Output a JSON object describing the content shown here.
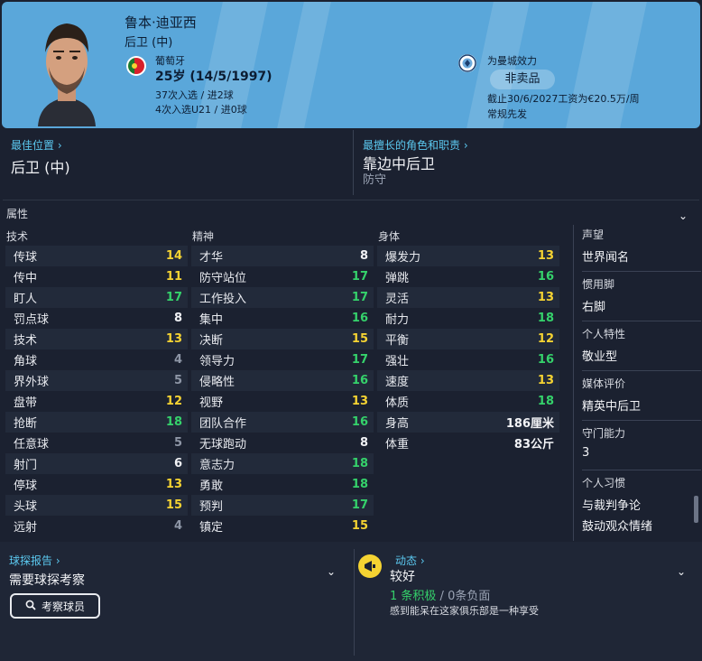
{
  "player": {
    "name": "鲁本·迪亚西",
    "position": "后卫 (中)",
    "nationality": "葡萄牙",
    "age": "25岁",
    "dob": "(14/5/1997)",
    "caps": "37次入选 / 进2球",
    "u21_caps": "4次入选U21 / 进0球"
  },
  "club": {
    "plays_for": "为曼城效力",
    "not_for_sale": "非卖品",
    "contract": "截止30/6/2027工资为€20.5万/周",
    "squad_role": "常规先发"
  },
  "positions": {
    "best_label": "最佳位置",
    "best_value": "后卫 (中)",
    "role_label": "最擅长的角色和职责",
    "role_value": "靠边中后卫",
    "duty": "防守"
  },
  "attributes": {
    "section_title": "属性",
    "technical_title": "技术",
    "mental_title": "精神",
    "physical_title": "身体",
    "technical": [
      {
        "name": "传球",
        "value": "14",
        "tone": "yellow"
      },
      {
        "name": "传中",
        "value": "11",
        "tone": "yellow"
      },
      {
        "name": "盯人",
        "value": "17",
        "tone": "green"
      },
      {
        "name": "罚点球",
        "value": "8",
        "tone": "white"
      },
      {
        "name": "技术",
        "value": "13",
        "tone": "yellow"
      },
      {
        "name": "角球",
        "value": "4",
        "tone": "gray"
      },
      {
        "name": "界外球",
        "value": "5",
        "tone": "gray"
      },
      {
        "name": "盘带",
        "value": "12",
        "tone": "yellow"
      },
      {
        "name": "抢断",
        "value": "18",
        "tone": "green"
      },
      {
        "name": "任意球",
        "value": "5",
        "tone": "gray"
      },
      {
        "name": "射门",
        "value": "6",
        "tone": "white"
      },
      {
        "name": "停球",
        "value": "13",
        "tone": "yellow"
      },
      {
        "name": "头球",
        "value": "15",
        "tone": "yellow"
      },
      {
        "name": "远射",
        "value": "4",
        "tone": "gray"
      }
    ],
    "mental": [
      {
        "name": "才华",
        "value": "8",
        "tone": "white"
      },
      {
        "name": "防守站位",
        "value": "17",
        "tone": "green"
      },
      {
        "name": "工作投入",
        "value": "17",
        "tone": "green"
      },
      {
        "name": "集中",
        "value": "16",
        "tone": "green"
      },
      {
        "name": "决断",
        "value": "15",
        "tone": "yellow"
      },
      {
        "name": "领导力",
        "value": "17",
        "tone": "green"
      },
      {
        "name": "侵略性",
        "value": "16",
        "tone": "green"
      },
      {
        "name": "视野",
        "value": "13",
        "tone": "yellow"
      },
      {
        "name": "团队合作",
        "value": "16",
        "tone": "green"
      },
      {
        "name": "无球跑动",
        "value": "8",
        "tone": "white"
      },
      {
        "name": "意志力",
        "value": "18",
        "tone": "green"
      },
      {
        "name": "勇敢",
        "value": "18",
        "tone": "green"
      },
      {
        "name": "预判",
        "value": "17",
        "tone": "green"
      },
      {
        "name": "镇定",
        "value": "15",
        "tone": "yellow"
      }
    ],
    "physical": [
      {
        "name": "爆发力",
        "value": "13",
        "tone": "yellow"
      },
      {
        "name": "弹跳",
        "value": "16",
        "tone": "green"
      },
      {
        "name": "灵活",
        "value": "13",
        "tone": "yellow"
      },
      {
        "name": "耐力",
        "value": "18",
        "tone": "green"
      },
      {
        "name": "平衡",
        "value": "12",
        "tone": "yellow"
      },
      {
        "name": "强壮",
        "value": "16",
        "tone": "green"
      },
      {
        "name": "速度",
        "value": "13",
        "tone": "yellow"
      },
      {
        "name": "体质",
        "value": "18",
        "tone": "green"
      },
      {
        "name": "身高",
        "value": "186厘米",
        "tone": "white"
      },
      {
        "name": "体重",
        "value": "83公斤",
        "tone": "white"
      }
    ]
  },
  "side": {
    "reputation_label": "声望",
    "reputation_value": "世界闻名",
    "foot_label": "惯用脚",
    "foot_value": "右脚",
    "personality_label": "个人特性",
    "personality_value": "敬业型",
    "media_label": "媒体评价",
    "media_value": "精英中后卫",
    "gk_label": "守门能力",
    "gk_value": "3",
    "habits_label": "个人习惯",
    "habit1": "与裁判争论",
    "habit2": "鼓动观众情绪"
  },
  "scout": {
    "label": "球探报告",
    "value": "需要球探考察",
    "button": "考察球员"
  },
  "dynamics": {
    "label": "动态",
    "value": "较好",
    "positive": "1 条积极",
    "sep": "/",
    "negative": "0条负面",
    "note": "感到能呆在这家俱乐部是一种享受"
  },
  "colors": {
    "header_bg": "#5aa7da",
    "accent": "#5bc8ef",
    "good": "#35d26b",
    "mid": "#f5d332",
    "low": "#8e96a6"
  }
}
